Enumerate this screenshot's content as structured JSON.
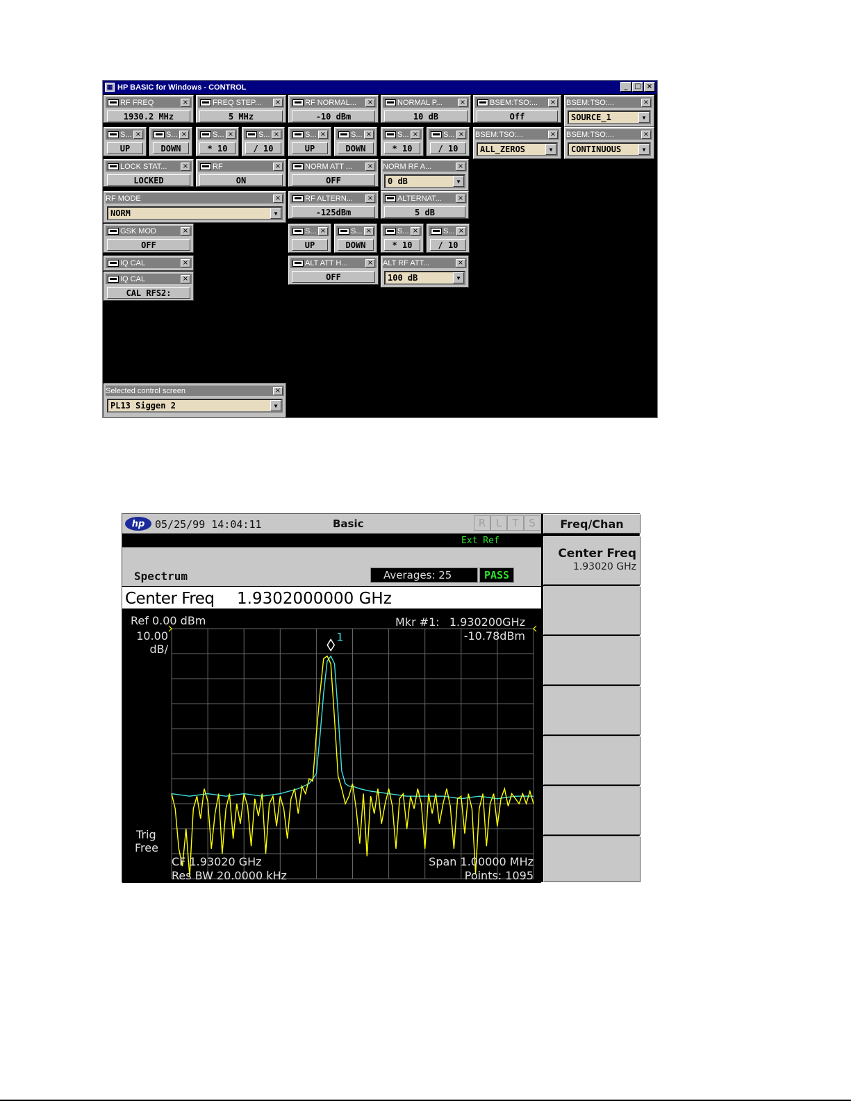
{
  "control_window": {
    "title": "HP BASIC for Windows - CONTROL",
    "win_buttons": [
      "_",
      "□",
      "×"
    ],
    "panels": {
      "rf_freq": {
        "title": "RF FREQ",
        "value": "1930.2 MHz"
      },
      "freq_step": {
        "title": "FREQ STEP...",
        "value": "5 MHz"
      },
      "rf_normal": {
        "title": "RF NORMAL...",
        "value": "-10 dBm"
      },
      "normal_p": {
        "title": "NORMAL P...",
        "value": "10 dB"
      },
      "bsem_tso_1": {
        "title": "BSEM:TSO:...",
        "value": "Off"
      },
      "bsem_tso_2": {
        "title": "BSEM:TSO:...",
        "value": "SOURCE_1"
      },
      "s_up_1": {
        "title": "S...",
        "value": "UP"
      },
      "s_down_1": {
        "title": "S...",
        "value": "DOWN"
      },
      "s_x10_1": {
        "title": "S...",
        "value": "* 10"
      },
      "s_d10_1": {
        "title": "S...",
        "value": "/ 10"
      },
      "s_up_2": {
        "title": "S...",
        "value": "UP"
      },
      "s_down_2": {
        "title": "S...",
        "value": "DOWN"
      },
      "s_x10_2": {
        "title": "S...",
        "value": "* 10"
      },
      "s_d10_2": {
        "title": "S...",
        "value": "/ 10"
      },
      "bsem_tso_3": {
        "title": "BSEM:TSO:...",
        "value": "ALL_ZEROS"
      },
      "bsem_tso_4": {
        "title": "BSEM:TSO:...",
        "value": "CONTINUOUS"
      },
      "lock_stat": {
        "title": "LOCK STAT...",
        "value": "LOCKED"
      },
      "rf": {
        "title": "RF",
        "value": "ON"
      },
      "norm_att": {
        "title": "NORM ATT ...",
        "value": "OFF"
      },
      "norm_rf_a": {
        "title": "NORM RF A...",
        "value": "0 dB"
      },
      "rf_mode": {
        "title": "RF MODE",
        "value": "NORM"
      },
      "rf_altern": {
        "title": "RF ALTERN...",
        "value": "-125dBm"
      },
      "alternat": {
        "title": "ALTERNAT...",
        "value": "5 dB"
      },
      "gsk_mod": {
        "title": "GSK MOD",
        "value": "OFF"
      },
      "s_up_3": {
        "title": "S...",
        "value": "UP"
      },
      "s_down_3": {
        "title": "S...",
        "value": "DOWN"
      },
      "s_x10_3": {
        "title": "S...",
        "value": "* 10"
      },
      "s_d10_3": {
        "title": "S...",
        "value": "/ 10"
      },
      "iq_cal_1": {
        "title": "IQ CAL"
      },
      "iq_cal_2": {
        "title": "IQ CAL",
        "value": "CAL RFS2:"
      },
      "alt_att_h": {
        "title": "ALT ATT H...",
        "value": "OFF"
      },
      "alt_rf_att": {
        "title": "ALT RF ATT...",
        "value": "100 dB"
      },
      "selected_screen": {
        "title": "Selected control screen",
        "value": "PL13 Siggen 2"
      }
    }
  },
  "analyzer": {
    "logo": "hp",
    "datetime": "05/25/99 14:04:11",
    "mode": "Basic",
    "status_letters": [
      "R",
      "L",
      "T",
      "S"
    ],
    "ext_ref": "Ext Ref",
    "measurement": "Spectrum",
    "averages": "Averages: 25",
    "pass": "PASS",
    "active_function": "Center Freq",
    "active_value": "1.9302000000 GHz",
    "ref_level": "Ref 0.00 dBm",
    "scale_value": "10.00",
    "scale_unit": "dB/",
    "marker_label": "Mkr #1:",
    "marker_freq": "1.930200GHz",
    "marker_amp": "-10.78dBm",
    "marker_number": "1",
    "trig_1": "Trig",
    "trig_2": "Free",
    "cf": "CF 1.93020 GHz",
    "res_bw": "Res BW 20.0000 kHz",
    "span": "Span 1.00000 MHz",
    "points": "Points: 1095",
    "softkey_menu": "Freq/Chan",
    "softkey_1_label": "Center Freq",
    "softkey_1_value": "1.93020 GHz",
    "trace_colors": {
      "yellow": "#ffff00",
      "cyan": "#40e0e0"
    }
  },
  "chart_data": {
    "type": "line",
    "x_center_ghz": 1.9302,
    "x_span_mhz": 1.0,
    "ylim": [
      -100,
      0
    ],
    "grid": true,
    "series": [
      {
        "color": "yellow",
        "x_mhz": [
          -0.5,
          -0.49,
          -0.48,
          -0.47,
          -0.46,
          -0.45,
          -0.44,
          -0.43,
          -0.42,
          -0.41,
          -0.4,
          -0.39,
          -0.38,
          -0.37,
          -0.36,
          -0.35,
          -0.34,
          -0.33,
          -0.32,
          -0.31,
          -0.3,
          -0.29,
          -0.28,
          -0.27,
          -0.26,
          -0.25,
          -0.24,
          -0.23,
          -0.22,
          -0.21,
          -0.2,
          -0.19,
          -0.18,
          -0.17,
          -0.16,
          -0.15,
          -0.14,
          -0.13,
          -0.12,
          -0.11,
          -0.1,
          -0.09,
          -0.08,
          -0.07,
          -0.06,
          -0.05,
          -0.04,
          -0.03,
          -0.02,
          -0.01,
          0.0,
          0.01,
          0.02,
          0.03,
          0.04,
          0.05,
          0.06,
          0.07,
          0.08,
          0.09,
          0.1,
          0.11,
          0.12,
          0.13,
          0.14,
          0.15,
          0.16,
          0.17,
          0.18,
          0.19,
          0.2,
          0.21,
          0.22,
          0.23,
          0.24,
          0.25,
          0.26,
          0.27,
          0.28,
          0.29,
          0.3,
          0.31,
          0.32,
          0.33,
          0.34,
          0.35,
          0.36,
          0.37,
          0.38,
          0.39,
          0.4,
          0.41,
          0.42,
          0.43,
          0.44,
          0.45,
          0.46,
          0.47,
          0.48,
          0.49,
          0.5
        ],
        "y_dbm": [
          -66,
          -72,
          -88,
          -95,
          -80,
          -99,
          -72,
          -67,
          -76,
          -64,
          -69,
          -88,
          -74,
          -66,
          -90,
          -72,
          -66,
          -84,
          -70,
          -78,
          -66,
          -71,
          -87,
          -68,
          -75,
          -66,
          -90,
          -70,
          -67,
          -79,
          -67,
          -72,
          -84,
          -68,
          -64,
          -74,
          -63,
          -66,
          -60,
          -61,
          -42,
          -26,
          -12,
          -11,
          -14,
          -36,
          -59,
          -64,
          -70,
          -67,
          -62,
          -72,
          -86,
          -66,
          -91,
          -67,
          -74,
          -64,
          -78,
          -70,
          -64,
          -71,
          -88,
          -68,
          -66,
          -80,
          -67,
          -72,
          -64,
          -70,
          -88,
          -66,
          -74,
          -66,
          -78,
          -70,
          -64,
          -71,
          -88,
          -68,
          -67,
          -82,
          -66,
          -72,
          -98,
          -72,
          -66,
          -87,
          -70,
          -66,
          -79,
          -68,
          -64,
          -71,
          -66,
          -68,
          -70,
          -66,
          -70,
          -65,
          -70
        ]
      },
      {
        "color": "cyan",
        "x_mhz": [
          -0.5,
          -0.45,
          -0.4,
          -0.35,
          -0.3,
          -0.25,
          -0.2,
          -0.15,
          -0.12,
          -0.1,
          -0.09,
          -0.08,
          -0.07,
          -0.06,
          -0.05,
          -0.04,
          -0.03,
          -0.02,
          -0.01,
          0.0,
          0.02,
          0.05,
          0.1,
          0.15,
          0.2,
          0.25,
          0.3,
          0.35,
          0.4,
          0.45,
          0.5
        ],
        "y_dbm": [
          -66,
          -67,
          -66,
          -67,
          -66,
          -67,
          -66,
          -64,
          -62,
          -58,
          -43,
          -26,
          -13,
          -11,
          -14,
          -34,
          -57,
          -62,
          -63,
          -63,
          -64,
          -65,
          -66,
          -67,
          -67,
          -67,
          -68,
          -67,
          -68,
          -67,
          -67
        ]
      }
    ]
  }
}
